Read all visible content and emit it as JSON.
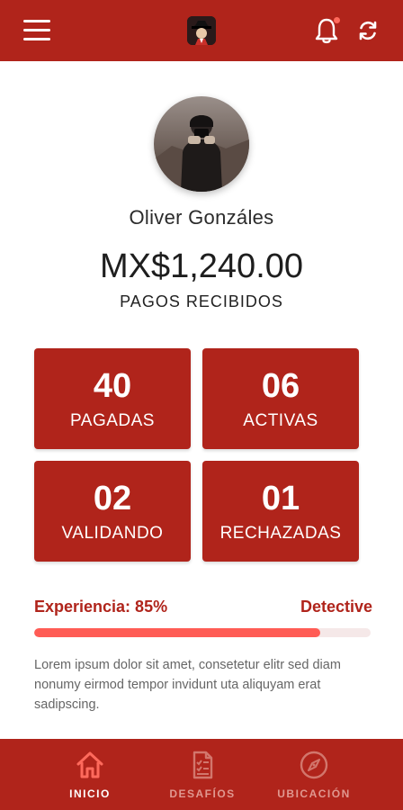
{
  "colors": {
    "primary": "#b0241b",
    "accent": "#ff5c55",
    "track": "#f5e8e8"
  },
  "header": {
    "menu_icon": "hamburger-menu-icon",
    "logo_icon": "detective-logo-icon",
    "notification_icon": "bell-icon",
    "refresh_icon": "refresh-icon",
    "has_notification": true
  },
  "profile": {
    "name": "Oliver Gonzáles",
    "balance": "MX$1,240.00",
    "balance_label": "PAGOS RECIBIDOS"
  },
  "stats": [
    {
      "value": "40",
      "label": "PAGADAS"
    },
    {
      "value": "06",
      "label": "ACTIVAS"
    },
    {
      "value": "02",
      "label": "VALIDANDO"
    },
    {
      "value": "01",
      "label": "RECHAZADAS"
    }
  ],
  "experience": {
    "label": "Experiencia: 85%",
    "rank": "Detective",
    "percent": 85
  },
  "description": "Lorem ipsum dolor sit amet, consetetur elitr sed diam nonumy eirmod tempor invidunt uta aliquyam erat sadipscing.",
  "nav": [
    {
      "label": "INICIO",
      "icon": "home-icon",
      "active": true
    },
    {
      "label": "DESAFÍOS",
      "icon": "checklist-icon",
      "active": false
    },
    {
      "label": "UBICACIÓN",
      "icon": "compass-icon",
      "active": false
    }
  ]
}
